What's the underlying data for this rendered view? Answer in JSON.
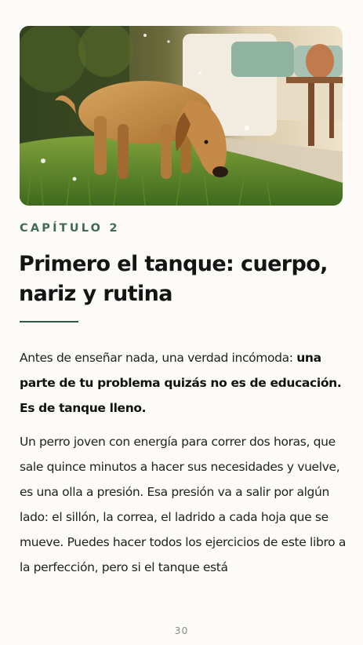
{
  "chapter_label": "CAPÍTULO 2",
  "title": "Primero el tanque: cuerpo, nariz y rutina",
  "paragraphs": {
    "p1_plain": "Antes de enseñar nada, una verdad incómoda: ",
    "p1_bold": "una parte de tu problema quizás no es de educación. Es de tanque lleno.",
    "p2": "Un perro joven con energía para correr dos horas, que sale quince minutos a hacer sus necesidades y vuelve, es una olla a presión. Esa presión va a salir por algún lado: el sillón, la correa, el ladrido a cada hoja que se mueve. Puedes hacer todos los ejercicios de este libro a la perfección, pero si el tanque está"
  },
  "page_number": "30",
  "colors": {
    "accent": "#3f6a57",
    "rule": "#2f5a48",
    "background": "#fcfbf8"
  }
}
